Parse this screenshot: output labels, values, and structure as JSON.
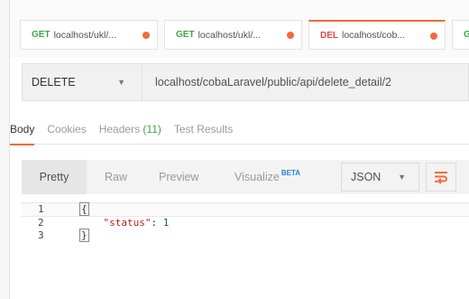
{
  "tabs": [
    {
      "method": "GET",
      "url": "localhost/ukl/...",
      "active": false
    },
    {
      "method": "GET",
      "url": "localhost/ukl/...",
      "active": false
    },
    {
      "method": "DEL",
      "url": "localhost/cob...",
      "active": true
    },
    {
      "method": "G",
      "url": "",
      "active": false
    }
  ],
  "request": {
    "method": "DELETE",
    "url": "localhost/cobaLaravel/public/api/delete_detail/2"
  },
  "response_tabs": {
    "body": "Body",
    "cookies": "Cookies",
    "headers_label": "Headers",
    "headers_count": "(11)",
    "test_results": "Test Results"
  },
  "view_modes": {
    "pretty": "Pretty",
    "raw": "Raw",
    "preview": "Preview",
    "visualize": "Visualize",
    "visualize_badge": "BETA"
  },
  "format": "JSON",
  "code": {
    "line_numbers": [
      "1",
      "2",
      "3"
    ],
    "open_brace": "{",
    "indent": "    ",
    "key": "\"status\"",
    "sep": ": ",
    "value": "1",
    "close_brace": "}"
  },
  "colors": {
    "accent": "#f26b3a",
    "get": "#3fa64a",
    "delete": "#e0474c",
    "beta": "#2a7fdd"
  }
}
